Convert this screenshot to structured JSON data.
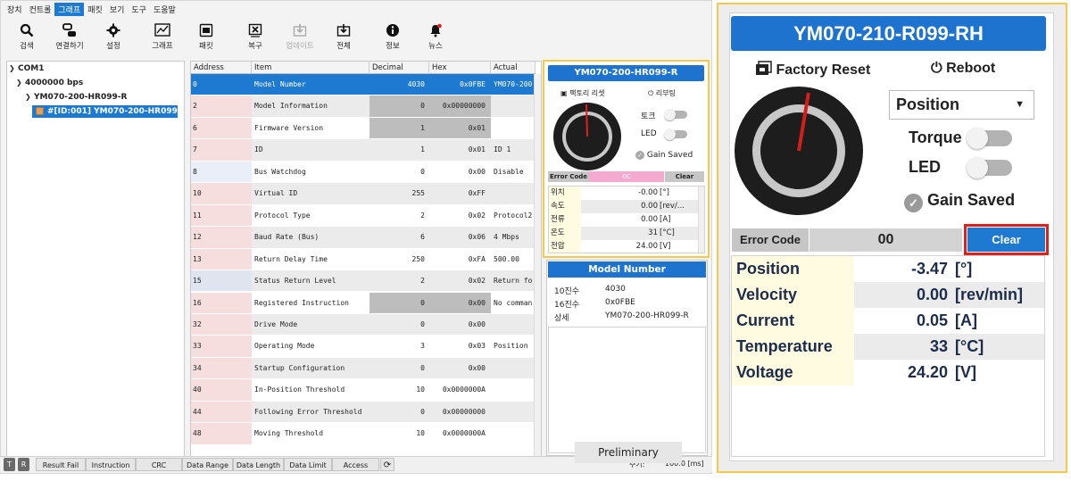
{
  "menu": [
    "장치",
    "컨트롤",
    "그래프",
    "패킷",
    "보기",
    "도구",
    "도움말"
  ],
  "menu_active_index": 2,
  "toolbar": [
    {
      "label": "검색",
      "icon": "search-icon"
    },
    {
      "label": "연결하기",
      "icon": "connect-icon"
    },
    {
      "label": "설정",
      "icon": "gear-icon"
    },
    {
      "label": "그래프",
      "icon": "graph-icon"
    },
    {
      "label": "패킷",
      "icon": "packet-icon"
    },
    {
      "label": "복구",
      "icon": "recover-icon"
    },
    {
      "label": "업데이트",
      "icon": "update-icon"
    },
    {
      "label": "전체",
      "icon": "all-icon"
    },
    {
      "label": "정보",
      "icon": "info-icon"
    },
    {
      "label": "뉴스",
      "icon": "news-icon"
    }
  ],
  "tree": {
    "port": "COM1",
    "baud": "4000000 bps",
    "model": "YM070-200-HR099-R",
    "device": "#[ID:001] YM070-200-HR099..."
  },
  "grid": {
    "headers": [
      "Address",
      "Item",
      "Decimal",
      "Hex",
      "Actual"
    ],
    "rows": [
      [
        "0",
        "Model Number",
        "4030",
        "0x0FBE",
        "YM070-200"
      ],
      [
        "2",
        "Model Information",
        "0",
        "0x00000000",
        ""
      ],
      [
        "6",
        "Firmware Version",
        "1",
        "0x01",
        ""
      ],
      [
        "7",
        "ID",
        "1",
        "0x01",
        "ID 1"
      ],
      [
        "8",
        "Bus Watchdog",
        "0",
        "0x00",
        "Disable"
      ],
      [
        "10",
        "Virtual ID",
        "255",
        "0xFF",
        ""
      ],
      [
        "11",
        "Protocol Type",
        "2",
        "0x02",
        "Protocol2"
      ],
      [
        "12",
        "Baud Rate (Bus)",
        "6",
        "0x06",
        "4 Mbps"
      ],
      [
        "13",
        "Return Delay Time",
        "250",
        "0xFA",
        "500.00"
      ],
      [
        "15",
        "Status Return Level",
        "2",
        "0x02",
        "Return fo"
      ],
      [
        "16",
        "Registered Instruction",
        "0",
        "0x00",
        "No comman"
      ],
      [
        "32",
        "Drive Mode",
        "0",
        "0x00",
        ""
      ],
      [
        "33",
        "Operating Mode",
        "3",
        "0x03",
        "Position"
      ],
      [
        "34",
        "Startup Configuration",
        "0",
        "0x00",
        ""
      ],
      [
        "40",
        "In-Position Threshold",
        "10",
        "0x0000000A",
        ""
      ],
      [
        "44",
        "Following Error Threshold",
        "0",
        "0x00000000",
        ""
      ],
      [
        "48",
        "Moving Threshold",
        "10",
        "0x0000000A",
        ""
      ]
    ]
  },
  "statusbar": {
    "t": "T",
    "r": "R",
    "buttons": [
      "Result Fail",
      "Instruction",
      "CRC",
      "Data Range",
      "Data Length",
      "Data Limit",
      "Access"
    ],
    "period_label": "주기:",
    "period_value": "100.0 [ms]"
  },
  "mini": {
    "title": "YM070-200-HR099-R",
    "factory_reset": "팩토리 리셋",
    "reboot": "리부팅",
    "torque": "토크",
    "led": "LED",
    "gain_saved": "Gain Saved",
    "error_code_label": "Error Code",
    "error_code_value": "0C",
    "clear": "Clear",
    "rows": [
      {
        "label": "위치",
        "value": "-0.00",
        "unit": "[°]"
      },
      {
        "label": "속도",
        "value": "0.00",
        "unit": "[rev/..."
      },
      {
        "label": "전류",
        "value": "0.00",
        "unit": "[A]"
      },
      {
        "label": "온도",
        "value": "31",
        "unit": "[°C]"
      },
      {
        "label": "전압",
        "value": "24.00",
        "unit": "[V]"
      }
    ]
  },
  "model_card": {
    "title": "Model Number",
    "rows": [
      {
        "label": "10진수",
        "value": "4030"
      },
      {
        "label": "16진수",
        "value": "0x0FBE"
      },
      {
        "label": "상세",
        "value": "YM070-200-HR099-R"
      }
    ],
    "preliminary": "Preliminary"
  },
  "big": {
    "title": "YM070-210-R099-RH",
    "factory_reset": "Factory Reset",
    "reboot": "Reboot",
    "mode": "Position",
    "torque": "Torque",
    "led": "LED",
    "gain_saved": "Gain Saved",
    "error_code_label": "Error Code",
    "error_code_value": "00",
    "clear": "Clear",
    "rows": [
      {
        "label": "Position",
        "value": "-3.47",
        "unit": "[°]"
      },
      {
        "label": "Velocity",
        "value": "0.00",
        "unit": "[rev/min]"
      },
      {
        "label": "Current",
        "value": "0.05",
        "unit": "[A]"
      },
      {
        "label": "Temperature",
        "value": "33",
        "unit": "[°C]"
      },
      {
        "label": "Voltage",
        "value": "24.20",
        "unit": "[V]"
      }
    ]
  },
  "colors": {
    "accent": "#1e73cf",
    "highlight": "#f7c948",
    "clear_outline": "#e0201c",
    "error_pink": "#f4a9cf"
  }
}
